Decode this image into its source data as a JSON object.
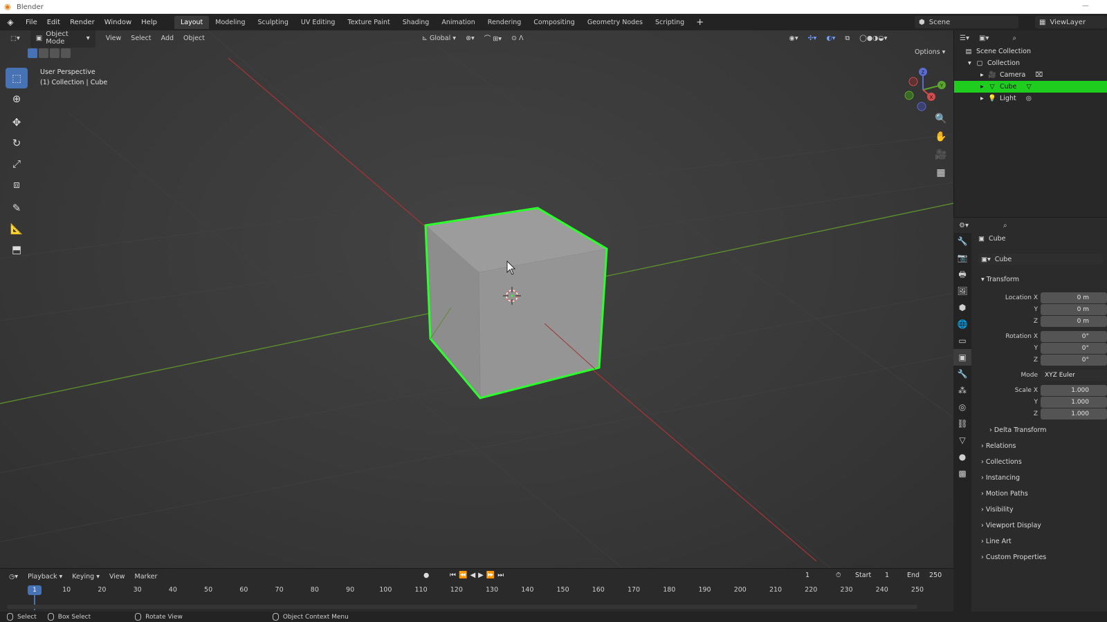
{
  "window": {
    "title": "Blender"
  },
  "menu": [
    "File",
    "Edit",
    "Render",
    "Window",
    "Help"
  ],
  "workspaces": [
    "Layout",
    "Modeling",
    "Sculpting",
    "UV Editing",
    "Texture Paint",
    "Shading",
    "Animation",
    "Rendering",
    "Compositing",
    "Geometry Nodes",
    "Scripting"
  ],
  "active_workspace": "Layout",
  "scene": {
    "label": "Scene"
  },
  "view_layer": {
    "label": "ViewLayer"
  },
  "viewport": {
    "mode": "Object Mode",
    "header_menus": [
      "View",
      "Select",
      "Add",
      "Object"
    ],
    "transform_orientation": "Global",
    "options_label": "Options",
    "info_line1": "User Perspective",
    "info_line2": "(1) Collection | Cube",
    "gizmo_axes": [
      "X",
      "Y",
      "Z"
    ],
    "accent_selected": "#2bff2b"
  },
  "outliner": {
    "items": [
      {
        "label": "Scene Collection",
        "icon": "scene-collection-icon"
      },
      {
        "label": "Collection",
        "icon": "collection-icon"
      },
      {
        "label": "Camera",
        "icon": "camera-icon"
      },
      {
        "label": "Cube",
        "icon": "mesh-icon",
        "selected": true
      },
      {
        "label": "Light",
        "icon": "light-icon"
      }
    ],
    "selection_color": "#1ecd1e"
  },
  "properties": {
    "object_name": "Cube",
    "object_field": "Cube",
    "transform_label": "Transform",
    "location": {
      "label": "Location X",
      "x": "0 m",
      "y": "0 m",
      "z": "0 m"
    },
    "rotation": {
      "label": "Rotation X",
      "x": "0°",
      "y": "0°",
      "z": "0°"
    },
    "mode": {
      "label": "Mode",
      "value": "XYZ Euler"
    },
    "scale": {
      "label": "Scale X",
      "x": "1.000",
      "y": "1.000",
      "z": "1.000"
    },
    "axis_y": "Y",
    "axis_z": "Z",
    "sections": [
      "Delta Transform",
      "Relations",
      "Collections",
      "Instancing",
      "Motion Paths",
      "Visibility",
      "Viewport Display",
      "Line Art",
      "Custom Properties"
    ]
  },
  "timeline": {
    "menus": [
      "Playback",
      "Keying",
      "View",
      "Marker"
    ],
    "current_frame": "1",
    "start_label": "Start",
    "start": "1",
    "end_label": "End",
    "end": "250",
    "ticks": [
      "10",
      "20",
      "30",
      "40",
      "50",
      "60",
      "70",
      "80",
      "90",
      "100",
      "110",
      "120",
      "130",
      "140",
      "150",
      "160",
      "170",
      "180",
      "190",
      "200",
      "210",
      "220",
      "230",
      "240",
      "250"
    ],
    "playhead": "1"
  },
  "status": {
    "select": "Select",
    "box_select": "Box Select",
    "rotate_view": "Rotate View",
    "context_menu": "Object Context Menu"
  }
}
